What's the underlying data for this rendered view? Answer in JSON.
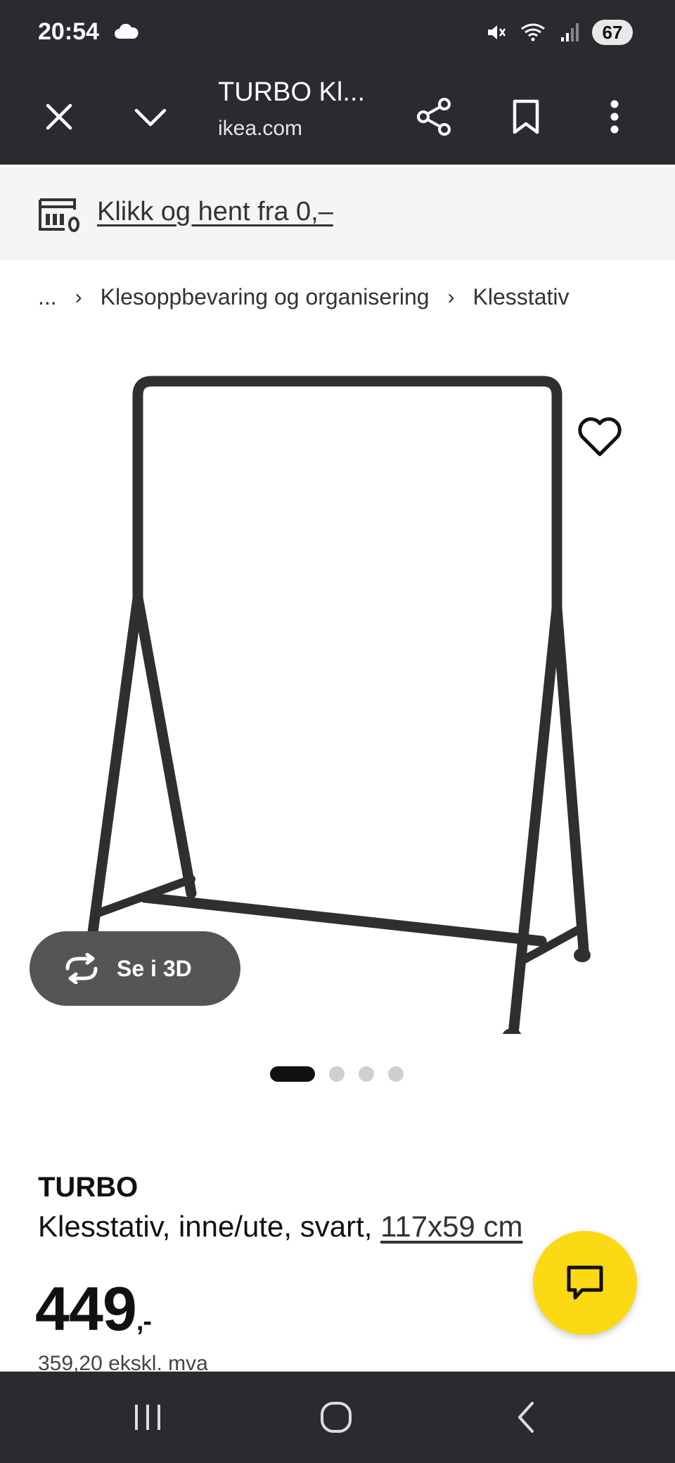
{
  "status_bar": {
    "time": "20:54",
    "battery": "67",
    "icons": [
      "cloud-icon",
      "mute-icon",
      "wifi-icon",
      "signal-icon"
    ]
  },
  "browser": {
    "title": "TURBO Kl...",
    "domain": "ikea.com",
    "buttons": [
      "close-icon",
      "chevron-down-icon",
      "share-icon",
      "bookmark-icon",
      "more-vert-icon"
    ]
  },
  "banner": {
    "label": "Klikk og hent fra 0,–"
  },
  "breadcrumb": {
    "items": [
      "...",
      "Klesoppbevaring og organisering",
      "Klesstativ"
    ]
  },
  "gallery": {
    "view_3d_label": "Se i 3D",
    "slides": 4,
    "active_slide": 1
  },
  "product": {
    "name": "TURBO",
    "description": "Klesstativ, inne/ute, svart, ",
    "dimensions": "117x59 cm",
    "price": "449",
    "price_suffix": ",-",
    "price_ex_vat": "359,20 ekskl. mva"
  },
  "colors": {
    "bar_bg": "#2a2a30",
    "banner_bg": "#f5f5f5",
    "chat_yellow": "#fbd914",
    "button_3d_bg": "#555555"
  }
}
